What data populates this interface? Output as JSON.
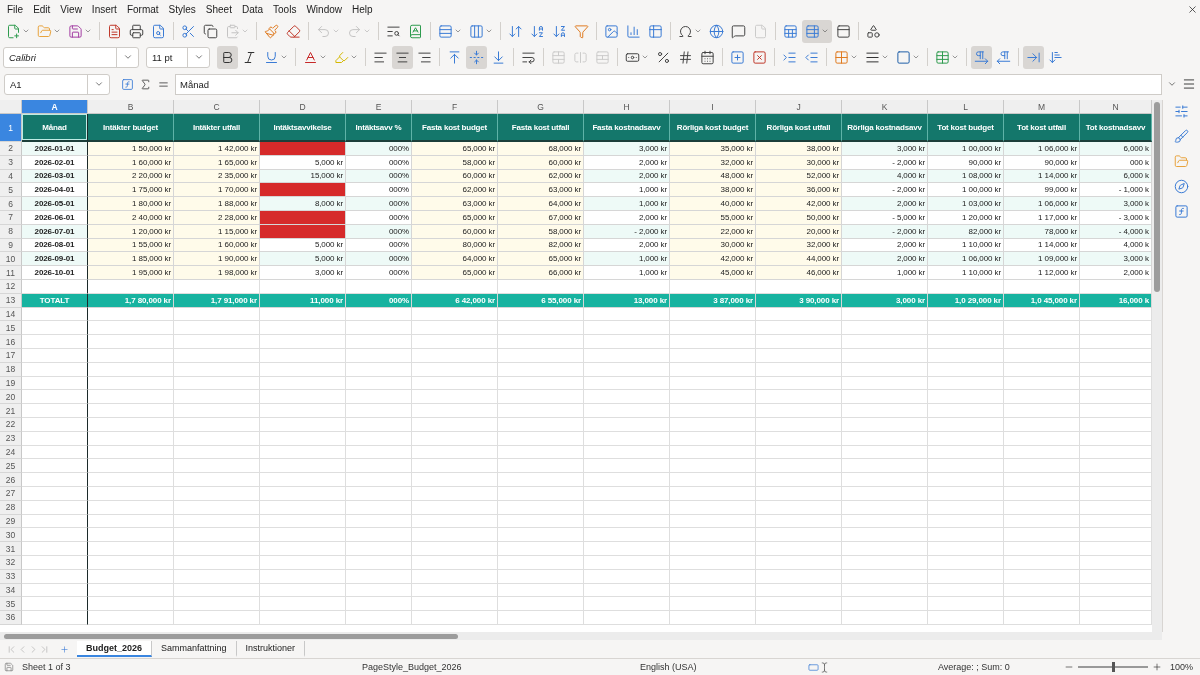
{
  "menu": [
    "File",
    "Edit",
    "View",
    "Insert",
    "Format",
    "Styles",
    "Sheet",
    "Data",
    "Tools",
    "Window",
    "Help"
  ],
  "toolbar1": [
    {
      "kind": "new",
      "dropdown": true,
      "disabled": false,
      "pressed": false
    },
    {
      "kind": "open",
      "dropdown": true,
      "disabled": false,
      "pressed": false
    },
    {
      "kind": "save",
      "dropdown": true,
      "disabled": false,
      "pressed": false
    },
    {
      "kind": "separator"
    },
    {
      "kind": "pdf",
      "dropdown": false,
      "disabled": false,
      "pressed": false
    },
    {
      "kind": "print",
      "dropdown": false,
      "disabled": false,
      "pressed": false
    },
    {
      "kind": "preview",
      "dropdown": false,
      "disabled": false,
      "pressed": false
    },
    {
      "kind": "separator"
    },
    {
      "kind": "cut",
      "dropdown": false,
      "disabled": false,
      "pressed": false
    },
    {
      "kind": "copy",
      "dropdown": false,
      "disabled": false,
      "pressed": false
    },
    {
      "kind": "paste",
      "dropdown": true,
      "disabled": true,
      "pressed": false
    },
    {
      "kind": "separator"
    },
    {
      "kind": "clone",
      "dropdown": false,
      "disabled": false,
      "pressed": false
    },
    {
      "kind": "clear",
      "dropdown": false,
      "disabled": false,
      "pressed": false
    },
    {
      "kind": "separator"
    },
    {
      "kind": "undo",
      "dropdown": true,
      "disabled": true,
      "pressed": false
    },
    {
      "kind": "redo",
      "dropdown": true,
      "disabled": true,
      "pressed": false
    },
    {
      "kind": "separator"
    },
    {
      "kind": "find",
      "dropdown": false,
      "disabled": false,
      "pressed": false
    },
    {
      "kind": "spelling",
      "dropdown": false,
      "disabled": false,
      "pressed": false
    },
    {
      "kind": "separator"
    },
    {
      "kind": "row",
      "dropdown": true,
      "disabled": false,
      "pressed": false
    },
    {
      "kind": "column",
      "dropdown": true,
      "disabled": false,
      "pressed": false
    },
    {
      "kind": "separator"
    },
    {
      "kind": "sort",
      "dropdown": false,
      "disabled": false,
      "pressed": false
    },
    {
      "kind": "sort-asc",
      "dropdown": false,
      "disabled": false,
      "pressed": false
    },
    {
      "kind": "sort-desc",
      "dropdown": false,
      "disabled": false,
      "pressed": false
    },
    {
      "kind": "filter",
      "dropdown": false,
      "disabled": false,
      "pressed": false
    },
    {
      "kind": "separator"
    },
    {
      "kind": "image",
      "dropdown": false,
      "disabled": false,
      "pressed": false
    },
    {
      "kind": "chart",
      "dropdown": false,
      "disabled": false,
      "pressed": false
    },
    {
      "kind": "pivot",
      "dropdown": false,
      "disabled": false,
      "pressed": false
    },
    {
      "kind": "separator"
    },
    {
      "kind": "special-char",
      "dropdown": true,
      "disabled": false,
      "pressed": false
    },
    {
      "kind": "hyperlink",
      "dropdown": false,
      "disabled": false,
      "pressed": false
    },
    {
      "kind": "comment",
      "dropdown": false,
      "disabled": false,
      "pressed": false
    },
    {
      "kind": "headerfooter",
      "dropdown": false,
      "disabled": true,
      "pressed": false
    },
    {
      "kind": "separator"
    },
    {
      "kind": "print-range",
      "dropdown": false,
      "disabled": false,
      "pressed": false
    },
    {
      "kind": "freeze",
      "dropdown": true,
      "disabled": false,
      "pressed": true
    },
    {
      "kind": "split",
      "dropdown": false,
      "disabled": false,
      "pressed": false
    },
    {
      "kind": "separator"
    },
    {
      "kind": "shapes",
      "dropdown": false,
      "disabled": false,
      "pressed": false
    }
  ],
  "font_name": "Calibri",
  "font_size": "11 pt",
  "toolbar2": [
    {
      "kind": "bold",
      "dropdown": false,
      "disabled": false,
      "pressed": true
    },
    {
      "kind": "italic",
      "dropdown": false,
      "disabled": false,
      "pressed": false
    },
    {
      "kind": "underline",
      "dropdown": true,
      "disabled": false,
      "pressed": false
    },
    {
      "kind": "separator"
    },
    {
      "kind": "font-color",
      "dropdown": true,
      "disabled": false,
      "pressed": false
    },
    {
      "kind": "highlight",
      "dropdown": true,
      "disabled": false,
      "pressed": false
    },
    {
      "kind": "separator"
    },
    {
      "kind": "align-left",
      "dropdown": false,
      "disabled": false,
      "pressed": false
    },
    {
      "kind": "align-center",
      "dropdown": false,
      "disabled": false,
      "pressed": true
    },
    {
      "kind": "align-right",
      "dropdown": false,
      "disabled": false,
      "pressed": false
    },
    {
      "kind": "separator"
    },
    {
      "kind": "valign-top",
      "dropdown": false,
      "disabled": false,
      "pressed": false
    },
    {
      "kind": "valign-middle",
      "dropdown": false,
      "disabled": false,
      "pressed": true
    },
    {
      "kind": "valign-bottom",
      "dropdown": false,
      "disabled": false,
      "pressed": false
    },
    {
      "kind": "separator"
    },
    {
      "kind": "wrap",
      "dropdown": false,
      "disabled": false,
      "pressed": false
    },
    {
      "kind": "separator"
    },
    {
      "kind": "merge-center",
      "dropdown": false,
      "disabled": true,
      "pressed": false
    },
    {
      "kind": "merge",
      "dropdown": false,
      "disabled": true,
      "pressed": false
    },
    {
      "kind": "unmerge",
      "dropdown": false,
      "disabled": true,
      "pressed": false
    },
    {
      "kind": "separator"
    },
    {
      "kind": "currency",
      "dropdown": true,
      "disabled": false,
      "pressed": false
    },
    {
      "kind": "percent",
      "dropdown": false,
      "disabled": false,
      "pressed": false
    },
    {
      "kind": "number",
      "dropdown": false,
      "disabled": false,
      "pressed": false
    },
    {
      "kind": "date",
      "dropdown": false,
      "disabled": false,
      "pressed": false
    },
    {
      "kind": "separator"
    },
    {
      "kind": "add-decimal",
      "dropdown": false,
      "disabled": false,
      "pressed": false
    },
    {
      "kind": "delete-decimal",
      "dropdown": false,
      "disabled": false,
      "pressed": false
    },
    {
      "kind": "separator"
    },
    {
      "kind": "indent-increase",
      "dropdown": false,
      "disabled": false,
      "pressed": false
    },
    {
      "kind": "indent-decrease",
      "dropdown": false,
      "disabled": false,
      "pressed": false
    },
    {
      "kind": "separator"
    },
    {
      "kind": "borders",
      "dropdown": true,
      "disabled": false,
      "pressed": false
    },
    {
      "kind": "border-style",
      "dropdown": true,
      "disabled": false,
      "pressed": false
    },
    {
      "kind": "border-color",
      "dropdown": true,
      "disabled": false,
      "pressed": false
    },
    {
      "kind": "separator"
    },
    {
      "kind": "conditional",
      "dropdown": true,
      "disabled": false,
      "pressed": false
    },
    {
      "kind": "separator"
    },
    {
      "kind": "ltr",
      "dropdown": false,
      "disabled": false,
      "pressed": true
    },
    {
      "kind": "rtl",
      "dropdown": false,
      "disabled": false,
      "pressed": false
    },
    {
      "kind": "separator"
    },
    {
      "kind": "text-horizontal",
      "dropdown": false,
      "disabled": false,
      "pressed": true
    },
    {
      "kind": "text-vertical",
      "dropdown": false,
      "disabled": false,
      "pressed": false
    }
  ],
  "name_box": "A1",
  "formula": "Månad",
  "columns": [
    {
      "letter": "A",
      "heading": "Månad",
      "selected": true
    },
    {
      "letter": "B",
      "heading": "Intäkter budget",
      "selected": false
    },
    {
      "letter": "C",
      "heading": "Intäkter utfall",
      "selected": false
    },
    {
      "letter": "D",
      "heading": "Intäktsavvikelse",
      "selected": false
    },
    {
      "letter": "E",
      "heading": "Intäktsavv %",
      "selected": false
    },
    {
      "letter": "F",
      "heading": "Fasta kost budget",
      "selected": false
    },
    {
      "letter": "G",
      "heading": "Fasta kost utfall",
      "selected": false
    },
    {
      "letter": "H",
      "heading": "Fasta kostnadsavv",
      "selected": false
    },
    {
      "letter": "I",
      "heading": "Rörliga kost budget",
      "selected": false
    },
    {
      "letter": "J",
      "heading": "Rörliga kost utfall",
      "selected": false
    },
    {
      "letter": "K",
      "heading": "Rörliga kostnadsavv",
      "selected": false
    },
    {
      "letter": "L",
      "heading": "Tot kost budget",
      "selected": false
    },
    {
      "letter": "M",
      "heading": "Tot kost utfall",
      "selected": false
    },
    {
      "letter": "N",
      "heading": "Tot kostnadsavv",
      "selected": false
    }
  ],
  "header_row": {
    "row": "1",
    "selected": true
  },
  "rows": [
    {
      "row": "2",
      "alert": true,
      "cells": [
        "2026-01-01",
        "1 50,000 kr",
        "1 42,000 kr",
        null,
        "000%",
        "65,000 kr",
        "68,000 kr",
        "3,000 kr",
        "35,000 kr",
        "38,000 kr",
        "3,000 kr",
        "1 00,000 kr",
        "1 06,000 kr",
        "6,000 k"
      ]
    },
    {
      "row": "3",
      "alert": false,
      "cells": [
        "2026-02-01",
        "1 60,000 kr",
        "1 65,000 kr",
        "5,000 kr",
        "000%",
        "58,000 kr",
        "60,000 kr",
        "2,000 kr",
        "32,000 kr",
        "30,000 kr",
        "- 2,000 kr",
        "90,000 kr",
        "90,000 kr",
        "000 k"
      ]
    },
    {
      "row": "4",
      "alert": false,
      "cells": [
        "2026-03-01",
        "2 20,000 kr",
        "2 35,000 kr",
        "15,000 kr",
        "000%",
        "60,000 kr",
        "62,000 kr",
        "2,000 kr",
        "48,000 kr",
        "52,000 kr",
        "4,000 kr",
        "1 08,000 kr",
        "1 14,000 kr",
        "6,000 k"
      ]
    },
    {
      "row": "5",
      "alert": true,
      "cells": [
        "2026-04-01",
        "1 75,000 kr",
        "1 70,000 kr",
        null,
        "000%",
        "62,000 kr",
        "63,000 kr",
        "1,000 kr",
        "38,000 kr",
        "36,000 kr",
        "- 2,000 kr",
        "1 00,000 kr",
        "99,000 kr",
        "- 1,000 k"
      ]
    },
    {
      "row": "6",
      "alert": false,
      "cells": [
        "2026-05-01",
        "1 80,000 kr",
        "1 88,000 kr",
        "8,000 kr",
        "000%",
        "63,000 kr",
        "64,000 kr",
        "1,000 kr",
        "40,000 kr",
        "42,000 kr",
        "2,000 kr",
        "1 03,000 kr",
        "1 06,000 kr",
        "3,000 k"
      ]
    },
    {
      "row": "7",
      "alert": true,
      "cells": [
        "2026-06-01",
        "2 40,000 kr",
        "2 28,000 kr",
        null,
        "000%",
        "65,000 kr",
        "67,000 kr",
        "2,000 kr",
        "55,000 kr",
        "50,000 kr",
        "- 5,000 kr",
        "1 20,000 kr",
        "1 17,000 kr",
        "- 3,000 k"
      ]
    },
    {
      "row": "8",
      "alert": true,
      "cells": [
        "2026-07-01",
        "1 20,000 kr",
        "1 15,000 kr",
        null,
        "000%",
        "60,000 kr",
        "58,000 kr",
        "- 2,000 kr",
        "22,000 kr",
        "20,000 kr",
        "- 2,000 kr",
        "82,000 kr",
        "78,000 kr",
        "- 4,000 k"
      ]
    },
    {
      "row": "9",
      "alert": false,
      "cells": [
        "2026-08-01",
        "1 55,000 kr",
        "1 60,000 kr",
        "5,000 kr",
        "000%",
        "80,000 kr",
        "82,000 kr",
        "2,000 kr",
        "30,000 kr",
        "32,000 kr",
        "2,000 kr",
        "1 10,000 kr",
        "1 14,000 kr",
        "4,000 k"
      ]
    },
    {
      "row": "10",
      "alert": false,
      "cells": [
        "2026-09-01",
        "1 85,000 kr",
        "1 90,000 kr",
        "5,000 kr",
        "000%",
        "64,000 kr",
        "65,000 kr",
        "1,000 kr",
        "42,000 kr",
        "44,000 kr",
        "2,000 kr",
        "1 06,000 kr",
        "1 09,000 kr",
        "3,000 k"
      ]
    },
    {
      "row": "11",
      "alert": false,
      "cells": [
        "2026-10-01",
        "1 95,000 kr",
        "1 98,000 kr",
        "3,000 kr",
        "000%",
        "65,000 kr",
        "66,000 kr",
        "1,000 kr",
        "45,000 kr",
        "46,000 kr",
        "1,000 kr",
        "1 10,000 kr",
        "1 12,000 kr",
        "2,000 k"
      ]
    }
  ],
  "spacer_row": "12",
  "total_row": {
    "row": "13",
    "cells": [
      "TOTALT",
      "1,7 80,000 kr",
      "1,7 91,000 kr",
      "11,000 kr",
      "000%",
      "6 42,000 kr",
      "6 55,000 kr",
      "13,000 kr",
      "3 87,000 kr",
      "3 90,000 kr",
      "3,000 kr",
      "1,0 29,000 kr",
      "1,0 45,000 kr",
      "16,000 k"
    ]
  },
  "empty_rows": [
    "14",
    "15",
    "16",
    "17",
    "18",
    "19",
    "20",
    "21",
    "22",
    "23",
    "24",
    "25",
    "26",
    "27",
    "28",
    "29",
    "30",
    "31",
    "32",
    "33",
    "34",
    "35",
    "36"
  ],
  "sheet_tabs": [
    {
      "label": "Budget_2026",
      "selected": true
    },
    {
      "label": "Sammanfattning",
      "selected": false
    },
    {
      "label": "Instruktioner",
      "selected": false
    }
  ],
  "status": {
    "sheet": "Sheet 1 of 3",
    "page_style": "PageStyle_Budget_2026",
    "language": "English (USA)",
    "selection": "Average: ; Sum: 0",
    "zoom": "100%",
    "zoom_slider": {
      "level": 0.5
    }
  }
}
